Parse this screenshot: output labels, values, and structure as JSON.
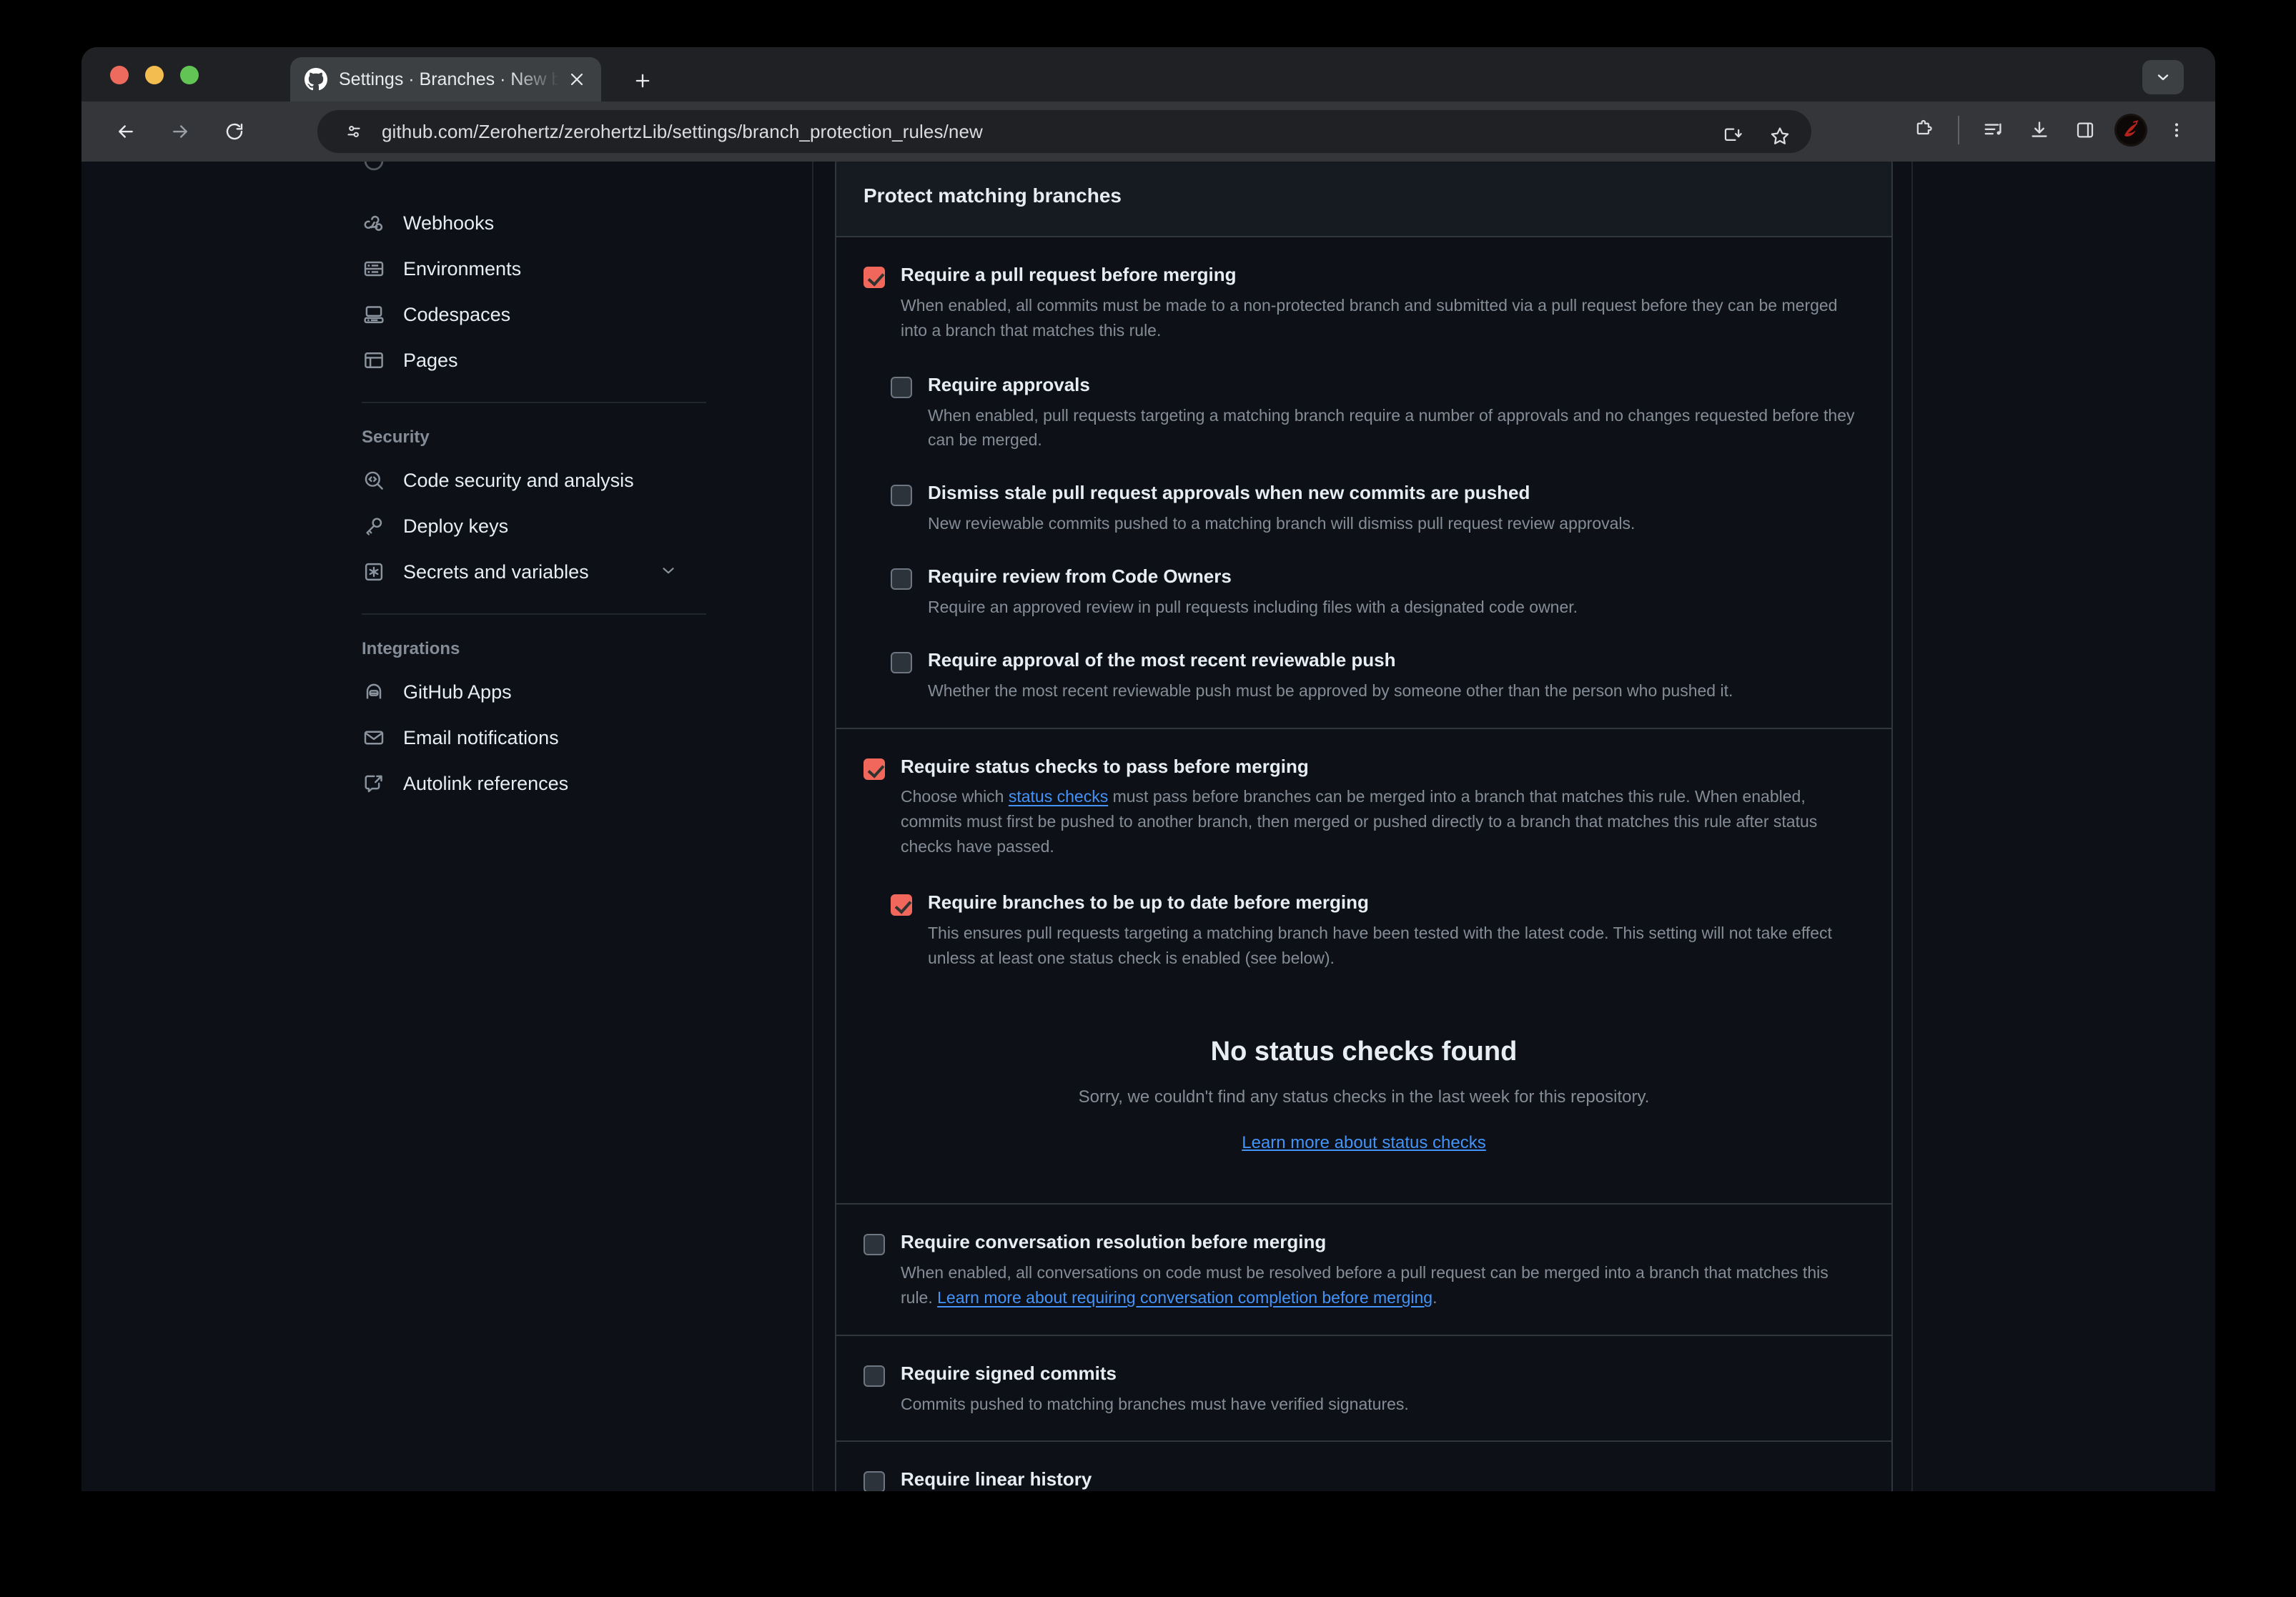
{
  "browser": {
    "tab": {
      "title": "Settings · Branches · New bra",
      "favicon": "github-icon",
      "close": "close-icon"
    },
    "new_tab": "plus-icon",
    "tab_search": "chevron-down-icon",
    "nav": {
      "back": "back-arrow-icon",
      "forward": "forward-arrow-icon",
      "reload": "reload-icon"
    },
    "omnibox": {
      "site_info": "site-settings-icon",
      "url": "github.com/Zerohertz/zerohertzLib/settings/branch_protection_rules/new",
      "install": "install-app-icon",
      "bookmark": "bookmark-star-icon"
    },
    "toolbar": {
      "extensions": "extensions-puzzle-icon",
      "media": "media-list-icon",
      "downloads": "download-icon",
      "side_panel": "side-panel-icon",
      "avatar": "profile-avatar",
      "menu": "three-dot-menu-icon"
    }
  },
  "sidebar": {
    "items_top": [
      {
        "label": "Webhooks",
        "icon": "webhook-icon"
      },
      {
        "label": "Environments",
        "icon": "server-icon"
      },
      {
        "label": "Codespaces",
        "icon": "codespaces-icon"
      },
      {
        "label": "Pages",
        "icon": "browser-window-icon"
      }
    ],
    "security_heading": "Security",
    "items_security": [
      {
        "label": "Code security and analysis",
        "icon": "code-scan-icon"
      },
      {
        "label": "Deploy keys",
        "icon": "key-icon"
      },
      {
        "label": "Secrets and variables",
        "icon": "asterisk-key-icon",
        "expander": "chevron-down-icon"
      }
    ],
    "integrations_heading": "Integrations",
    "items_integrations": [
      {
        "label": "GitHub Apps",
        "icon": "github-app-icon"
      },
      {
        "label": "Email notifications",
        "icon": "mail-icon"
      },
      {
        "label": "Autolink references",
        "icon": "cross-reference-icon"
      }
    ]
  },
  "main": {
    "panel_title": "Protect matching branches",
    "pull_request": {
      "title": "Require a pull request before merging",
      "checked": true,
      "desc": "When enabled, all commits must be made to a non-protected branch and submitted via a pull request before they can be merged into a branch that matches this rule.",
      "sub_options": [
        {
          "title": "Require approvals",
          "checked": false,
          "desc": "When enabled, pull requests targeting a matching branch require a number of approvals and no changes requested before they can be merged."
        },
        {
          "title": "Dismiss stale pull request approvals when new commits are pushed",
          "checked": false,
          "desc": "New reviewable commits pushed to a matching branch will dismiss pull request review approvals."
        },
        {
          "title": "Require review from Code Owners",
          "checked": false,
          "desc": "Require an approved review in pull requests including files with a designated code owner."
        },
        {
          "title": "Require approval of the most recent reviewable push",
          "checked": false,
          "desc": "Whether the most recent reviewable push must be approved by someone other than the person who pushed it."
        }
      ]
    },
    "status_checks": {
      "title": "Require status checks to pass before merging",
      "checked": true,
      "desc_pre": "Choose which ",
      "desc_link": "status checks",
      "desc_post": " must pass before branches can be merged into a branch that matches this rule. When enabled, commits must first be pushed to another branch, then merged or pushed directly to a branch that matches this rule after status checks have passed.",
      "up_to_date": {
        "title": "Require branches to be up to date before merging",
        "checked": true,
        "desc": "This ensures pull requests targeting a matching branch have been tested with the latest code. This setting will not take effect unless at least one status check is enabled (see below)."
      },
      "empty_title": "No status checks found",
      "empty_sub": "Sorry, we couldn't find any status checks in the last week for this repository.",
      "empty_link": "Learn more about status checks"
    },
    "conversation": {
      "title": "Require conversation resolution before merging",
      "checked": false,
      "desc_pre": "When enabled, all conversations on code must be resolved before a pull request can be merged into a branch that matches this rule. ",
      "desc_link": "Learn more about requiring conversation completion before merging",
      "desc_post": "."
    },
    "signed_commits": {
      "title": "Require signed commits",
      "checked": false,
      "desc": "Commits pushed to matching branches must have verified signatures."
    },
    "linear_history": {
      "title": "Require linear history",
      "checked": false
    }
  },
  "colors": {
    "accent_checked": "#f1675c",
    "link": "#4493f8",
    "page_bg": "#0d1117",
    "panel_header_bg": "#161b22",
    "border": "#30363d"
  }
}
